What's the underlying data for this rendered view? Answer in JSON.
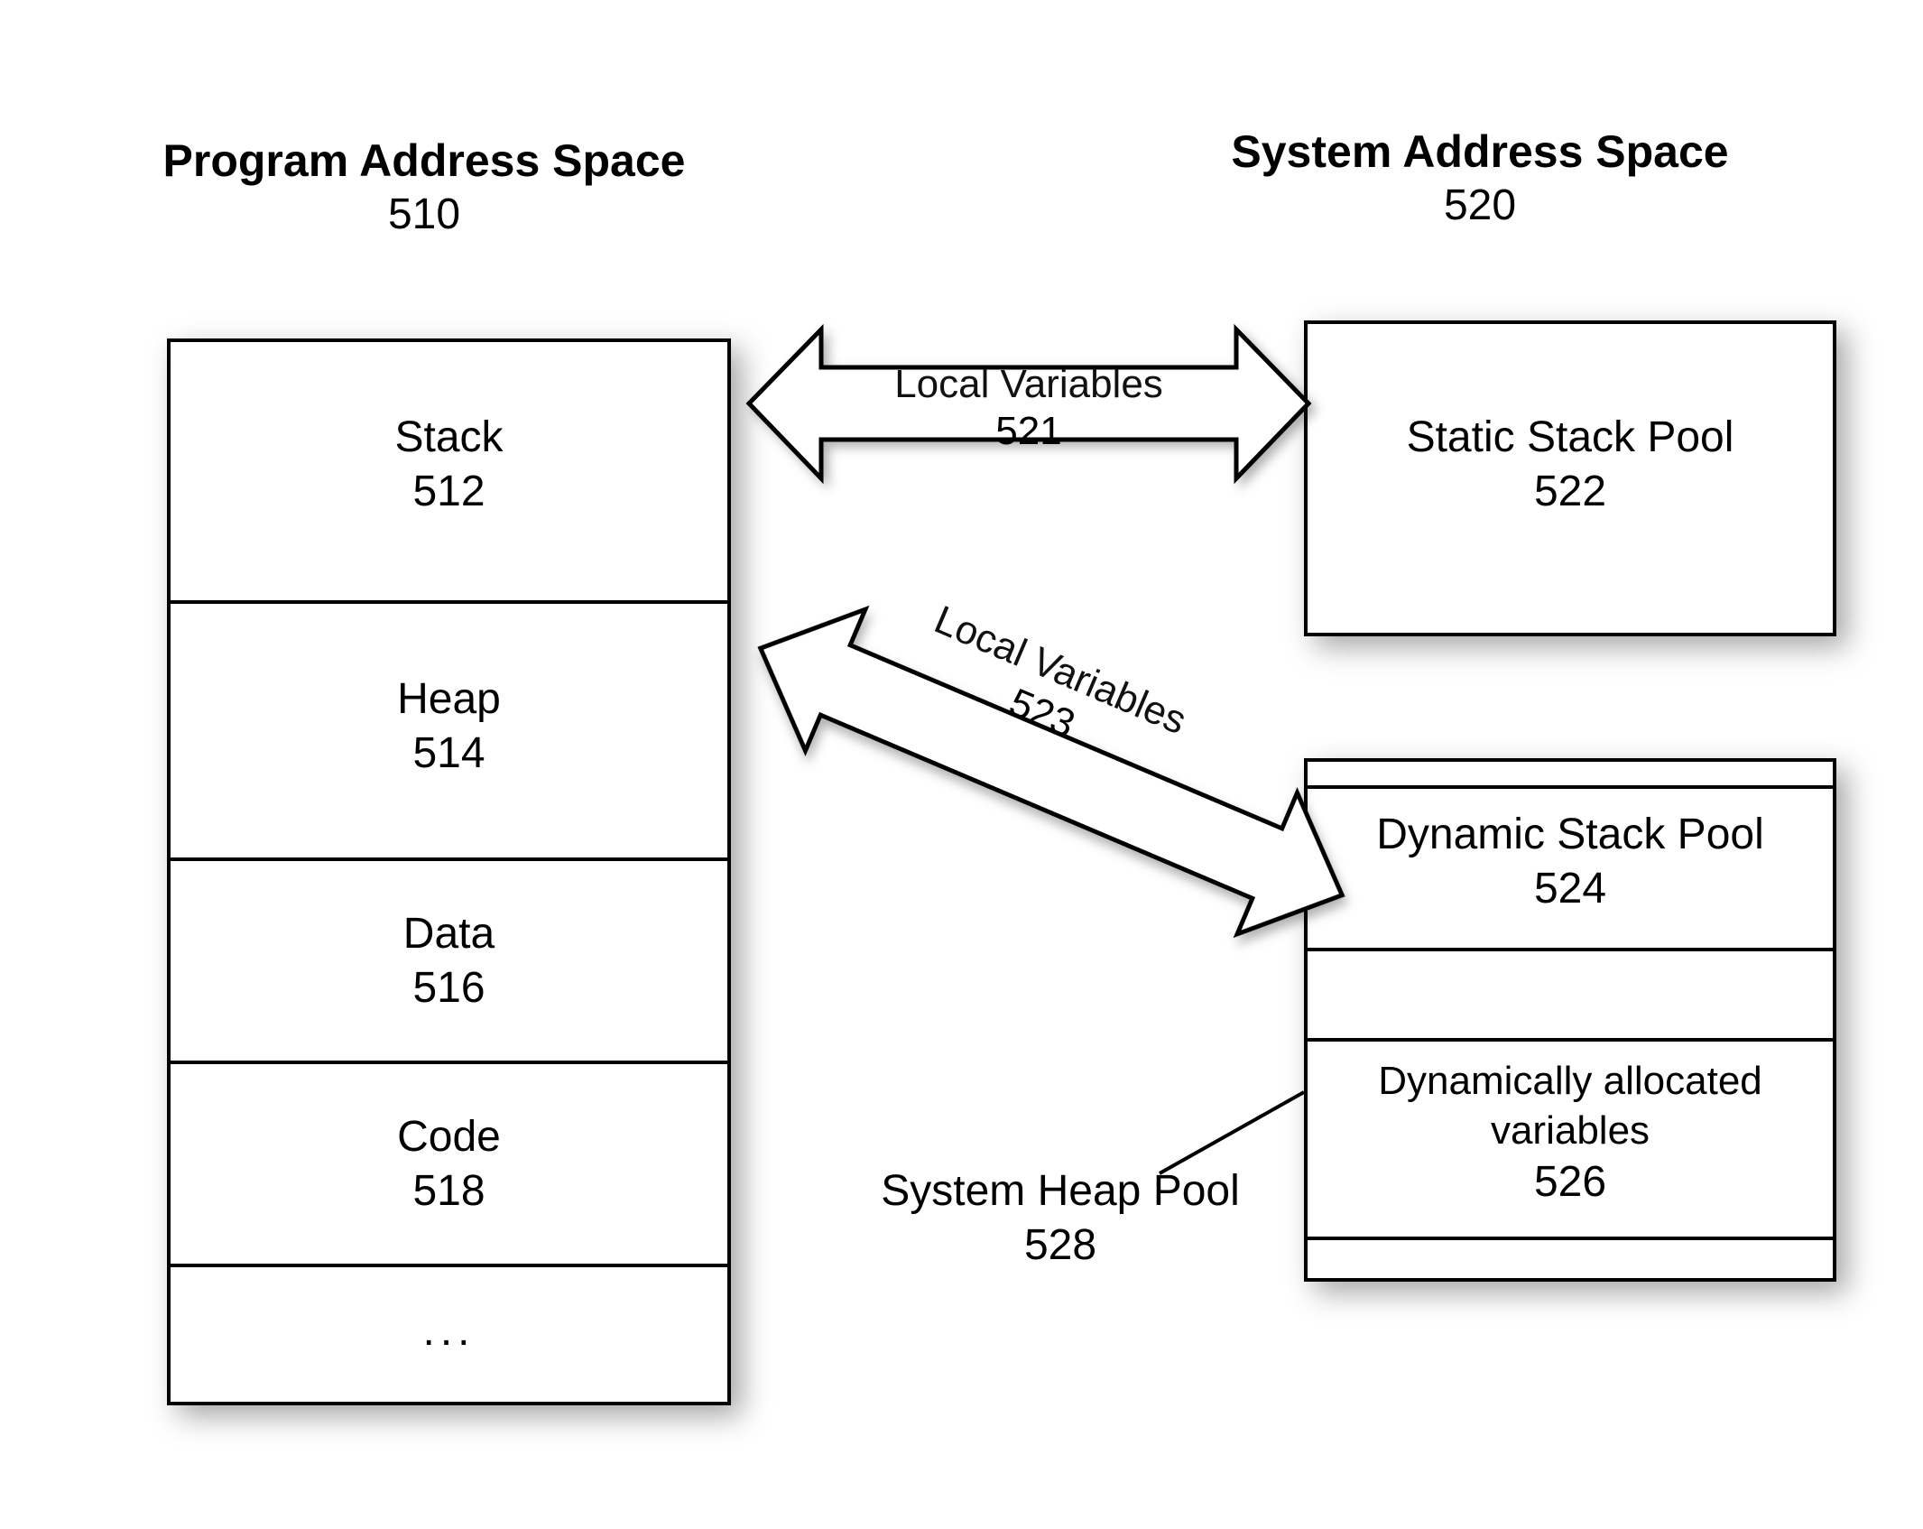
{
  "diagram": {
    "left": {
      "title": "Program Address Space",
      "number": "510",
      "cells": [
        {
          "label": "Stack",
          "number": "512"
        },
        {
          "label": "Heap",
          "number": "514"
        },
        {
          "label": "Data",
          "number": "516"
        },
        {
          "label": "Code",
          "number": "518"
        },
        {
          "label": "...",
          "number": ""
        }
      ]
    },
    "right": {
      "title": "System Address Space",
      "number": "520",
      "static_pool": {
        "label": "Static Stack Pool",
        "number": "522"
      },
      "dynamic_pool": {
        "label": "Dynamic Stack Pool",
        "number": "524"
      },
      "dyn_alloc": {
        "label": "Dynamically allocated variables",
        "number": "526"
      },
      "heap_pool": {
        "label": "System Heap Pool",
        "number": "528"
      }
    },
    "arrows": {
      "top": {
        "label": "Local Variables",
        "number": "521"
      },
      "diag": {
        "label": "Local Variables",
        "number": "523"
      }
    }
  }
}
